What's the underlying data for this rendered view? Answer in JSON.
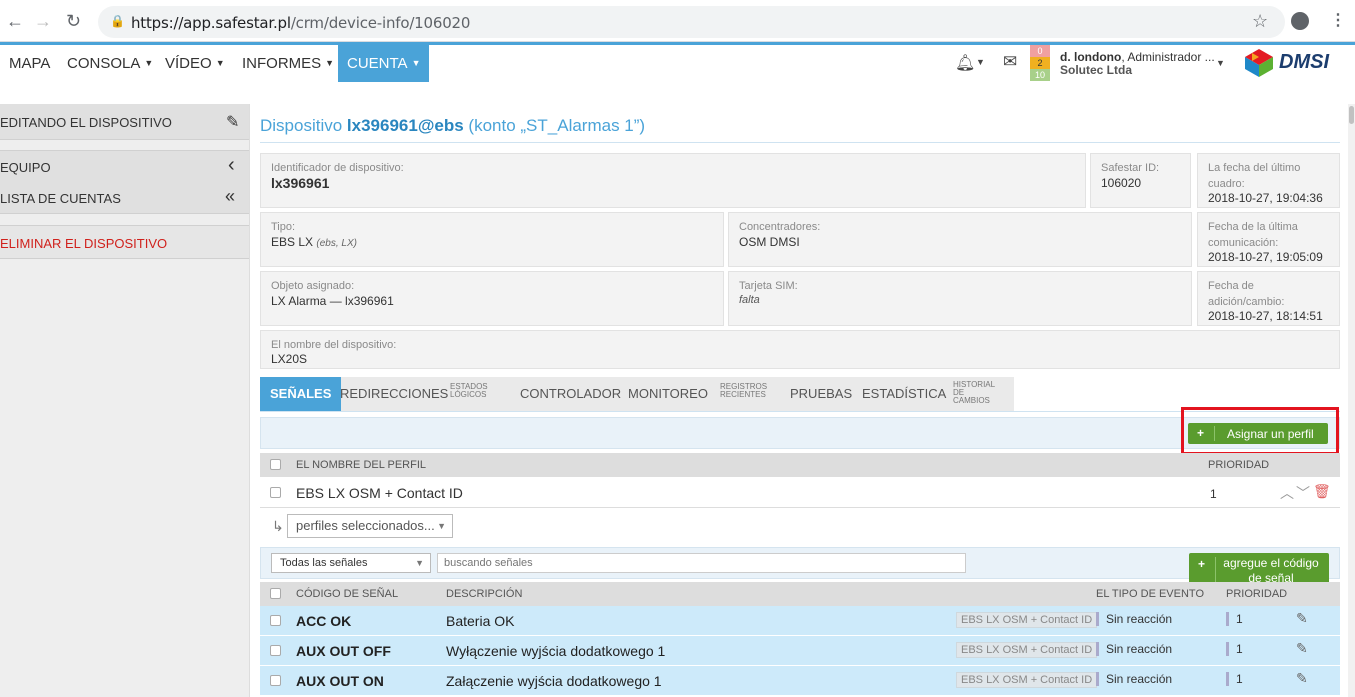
{
  "browser": {
    "url_host": "https://app.safestar.pl",
    "url_path": "/crm/device-info/106020"
  },
  "menu": [
    {
      "label": "MAPA",
      "has_caret": false
    },
    {
      "label": "CONSOLA",
      "has_caret": true
    },
    {
      "label": "VÍDEO",
      "has_caret": true
    },
    {
      "label": "INFORMES",
      "has_caret": true
    },
    {
      "label": "CUENTA",
      "has_caret": true,
      "active": true
    }
  ],
  "user": {
    "name": "d. londono",
    "role": ", Administrador ...",
    "company": "Solutec Ltda",
    "counters": [
      "0",
      "2",
      "10"
    ]
  },
  "brand": {
    "logo_text": "DMSI"
  },
  "sidebar": {
    "items": [
      {
        "label": "EDITANDO EL DISPOSITIVO",
        "icon": "pencil-icon",
        "glyph": "✎"
      },
      {
        "label": "EQUIPO",
        "icon": "chevron-left-icon",
        "glyph": "‹"
      },
      {
        "label": "LISTA DE CUENTAS",
        "icon": "double-chevron-left-icon",
        "glyph": "«"
      },
      {
        "label": "ELIMINAR EL DISPOSITIVO",
        "icon": "",
        "glyph": ""
      }
    ]
  },
  "device": {
    "title_prefix": "Dispositivo ",
    "title_id": "lx396961@ebs",
    "title_suffix": " (konto „ST_Alarmas 1”)",
    "identifier_label": "Identificador de dispositivo:",
    "identifier_value": "lx396961",
    "safestar_label": "Safestar ID:",
    "safestar_value": "106020",
    "last_frame_label": "La fecha del último cuadro:",
    "last_frame_value": "2018-10-27, 19:04:36",
    "type_label": "Tipo:",
    "type_value": "EBS LX",
    "type_extra": "(ebs, LX)",
    "concentrators_label": "Concentradores:",
    "concentrators_value": "OSM DMSI",
    "last_comm_label": "Fecha de la última comunicación:",
    "last_comm_value": "2018-10-27, 19:05:09",
    "object_label": "Objeto asignado:",
    "object_value": "LX Alarma — lx396961",
    "sim_label": "Tarjeta SIM:",
    "sim_value": "falta",
    "added_label": "Fecha de adición/cambio:",
    "added_value": "2018-10-27, 18:14:51",
    "name_label": "El nombre del dispositivo:",
    "name_value": "LX20S"
  },
  "tabs": [
    {
      "label": "SEÑALES",
      "active": true
    },
    {
      "label": "REDIRECCIONES"
    },
    {
      "label": "ESTADOS LÓGICOS",
      "small": true
    },
    {
      "label": "CONTROLADOR"
    },
    {
      "label": "MONITOREO"
    },
    {
      "label": "REGISTROS RECIENTES",
      "small": true
    },
    {
      "label": "PRUEBAS"
    },
    {
      "label": "ESTADÍSTICA"
    },
    {
      "label": "HISTORIAL DE CAMBIOS",
      "small": true
    }
  ],
  "profiles": {
    "assign_button": "Asignar un perfil",
    "plus": "+",
    "col_name": "EL NOMBRE DEL PERFIL",
    "col_priority": "PRIORIDAD",
    "rows": [
      {
        "name": "EBS LX OSM + Contact ID",
        "priority": "1"
      }
    ],
    "selected_placeholder": "perfiles seleccionados..."
  },
  "signals": {
    "filter_value": "Todas las señales",
    "search_placeholder": "buscando señales",
    "add_button": "agregue el código de señal",
    "col_code": "CÓDIGO DE SEÑAL",
    "col_desc": "DESCRIPCIÓN",
    "col_event": "EL TIPO DE EVENTO",
    "col_priority": "PRIORIDAD",
    "rows": [
      {
        "code": "ACC OK",
        "desc": "Bateria OK",
        "tag": "EBS LX OSM + Contact ID",
        "event": "Sin reacción",
        "priority": "1"
      },
      {
        "code": "AUX OUT OFF",
        "desc": "Wyłączenie wyjścia dodatkowego 1",
        "tag": "EBS LX OSM + Contact ID",
        "event": "Sin reacción",
        "priority": "1"
      },
      {
        "code": "AUX OUT ON",
        "desc": "Załączenie wyjścia dodatkowego 1",
        "tag": "EBS LX OSM + Contact ID",
        "event": "Sin reacción",
        "priority": "1"
      }
    ]
  },
  "colors": {
    "accent": "#4aa3d8",
    "green": "#5a9c2e",
    "highlight": "#e3141f",
    "row_bg": "#cdeafa",
    "delete": "#e06060"
  }
}
